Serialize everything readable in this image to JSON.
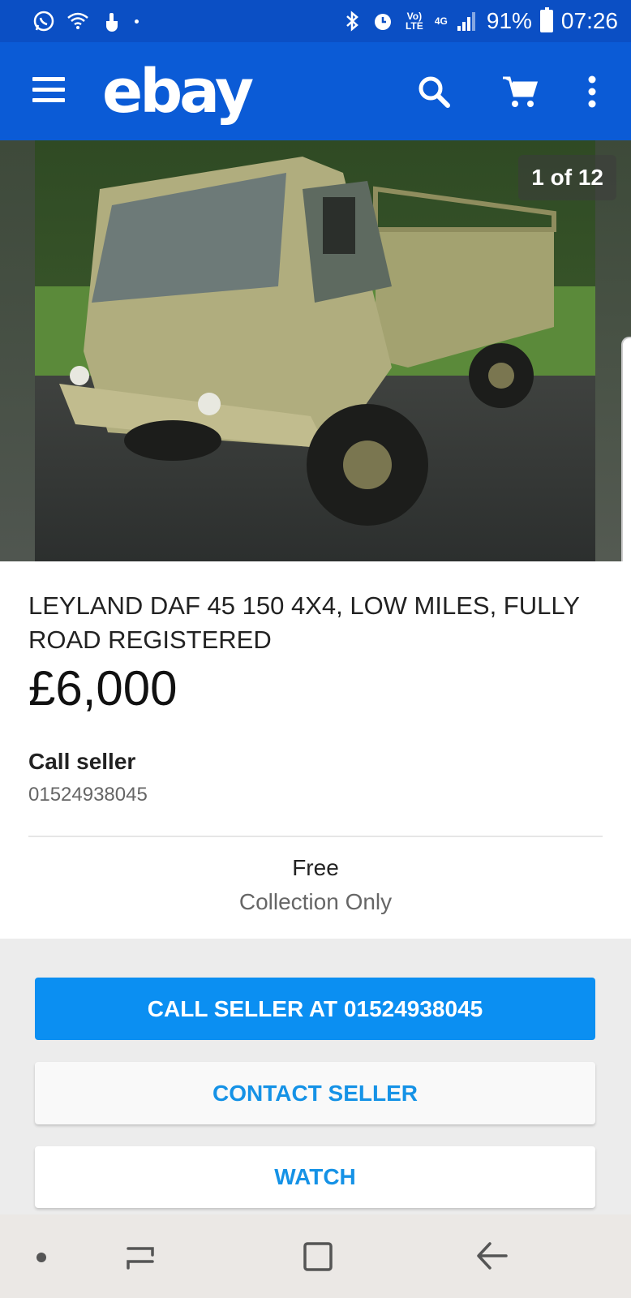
{
  "status_bar": {
    "lte_label": "Vo) LTE",
    "network_label": "4G",
    "battery_percent": "91%",
    "time": "07:26",
    "icons": [
      "whatsapp-icon",
      "wifi-icon",
      "touch-icon",
      "bluetooth-icon",
      "alarm-icon",
      "signal-icon",
      "battery-icon"
    ]
  },
  "app_bar": {
    "logo": "ebay",
    "icons": [
      "menu-icon",
      "search-icon",
      "cart-icon",
      "more-vert-icon"
    ]
  },
  "gallery": {
    "counter": "1 of 12",
    "image_description": "camouflage military truck"
  },
  "listing": {
    "title": "LEYLAND DAF 45 150 4X4, LOW MILES, FULLY ROAD REGISTERED",
    "price": "£6,000",
    "call_label": "Call seller",
    "phone": "01524938045",
    "shipping_price": "Free",
    "shipping_method": "Collection Only"
  },
  "actions": {
    "call_seller": "CALL SELLER AT 01524938045",
    "contact_seller": "CONTACT SELLER",
    "watch": "WATCH"
  },
  "colors": {
    "status_bar": "#0b4fc4",
    "app_bar": "#0b5bd6",
    "primary_button": "#0b8ff2",
    "link_blue": "#1592e6"
  }
}
